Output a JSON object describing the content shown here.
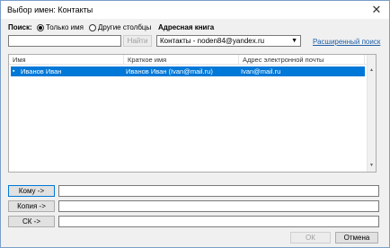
{
  "window": {
    "title": "Выбор имен: Контакты"
  },
  "search": {
    "label": "Поиск:",
    "option_name": "Только имя",
    "option_other": "Другие столбцы",
    "input_value": "",
    "find_button": "Найти"
  },
  "address_book": {
    "label": "Адресная книга",
    "selected": "Контакты - noden84@yandex.ru",
    "advanced_link": "Расширенный поиск"
  },
  "table": {
    "columns": [
      "Имя",
      "Краткое имя",
      "Адрес электронной почты"
    ],
    "rows": [
      {
        "name": "Иванов Иван",
        "short": "Иванов Иван (Ivan@mail.ru)",
        "email": "Ivan@mail.ru"
      }
    ]
  },
  "recipients": {
    "to_button": "Кому ->",
    "cc_button": "Копия ->",
    "bcc_button": "СК ->",
    "to_value": "",
    "cc_value": "",
    "bcc_value": ""
  },
  "footer": {
    "ok_button": "ОК",
    "cancel_button": "Отмена"
  },
  "colors": {
    "selection": "#0078d7",
    "link": "#1f5fa8"
  }
}
